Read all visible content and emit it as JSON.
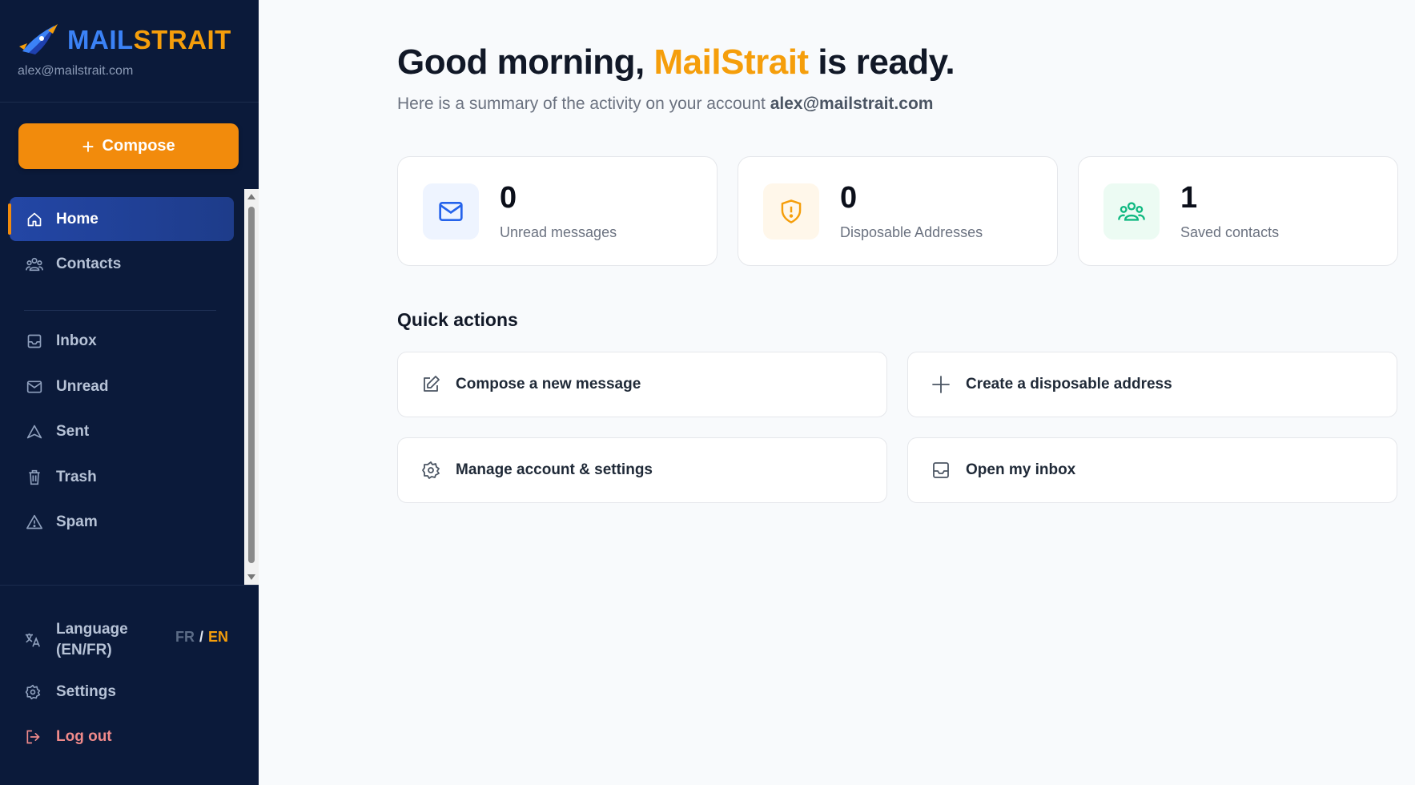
{
  "sidebar": {
    "brand": {
      "part1": "MAIL",
      "part2": "STRAIT"
    },
    "email": "alex@mailstrait.com",
    "compose_label": "Compose",
    "nav": [
      {
        "label": "Home",
        "icon": "home-icon"
      },
      {
        "label": "Contacts",
        "icon": "contacts-icon"
      },
      {
        "label": "Inbox",
        "icon": "inbox-icon"
      },
      {
        "label": "Unread",
        "icon": "mail-icon"
      },
      {
        "label": "Sent",
        "icon": "send-icon"
      },
      {
        "label": "Trash",
        "icon": "trash-icon"
      },
      {
        "label": "Spam",
        "icon": "warning-icon"
      }
    ],
    "bottom": {
      "language_line1": "Language",
      "language_line2": "(EN/FR)",
      "lang_fr": "FR",
      "lang_sep": "/",
      "lang_en": "EN",
      "settings": "Settings",
      "logout": "Log out"
    }
  },
  "main": {
    "greeting_start": "Good morning,",
    "greeting_brand": "MailStrait",
    "greeting_end": "is ready.",
    "subtitle_text": "Here is a summary of the activity on your account",
    "subtitle_email": "alex@mailstrait.com",
    "stats": [
      {
        "value": "0",
        "label": "Unread messages",
        "icon": "mail-icon",
        "color": "#2563eb"
      },
      {
        "value": "0",
        "label": "Disposable Addresses",
        "icon": "shield-icon",
        "color": "#f59e0b"
      },
      {
        "value": "1",
        "label": "Saved contacts",
        "icon": "users-icon",
        "color": "#10b981"
      }
    ],
    "quick_actions_title": "Quick actions",
    "quick_actions": [
      {
        "label": "Compose a new message",
        "icon": "edit-icon"
      },
      {
        "label": "Create a disposable address",
        "icon": "plus-icon"
      },
      {
        "label": "Manage account & settings",
        "icon": "gear-icon"
      },
      {
        "label": "Open my inbox",
        "icon": "inbox-icon"
      }
    ]
  },
  "colors": {
    "accent": "#f59e0b",
    "sidebar": "#0b1a3a",
    "brand_blue": "#3b82f6"
  }
}
